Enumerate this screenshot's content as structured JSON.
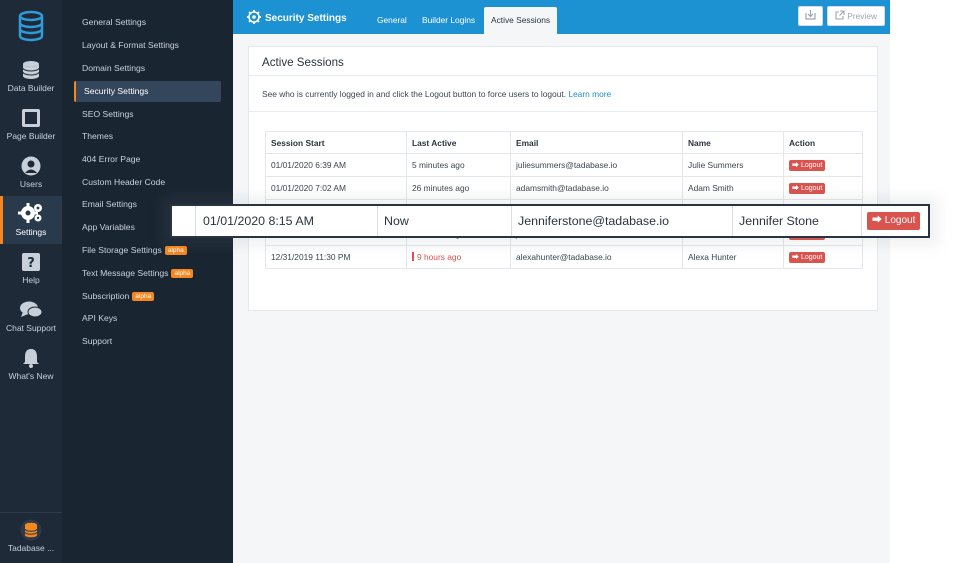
{
  "rail": {
    "items": [
      {
        "label": "Data Builder",
        "icon": "database-icon"
      },
      {
        "label": "Page Builder",
        "icon": "layout-icon"
      },
      {
        "label": "Users",
        "icon": "user-icon"
      },
      {
        "label": "Settings",
        "icon": "gear-icon",
        "active": true
      },
      {
        "label": "Help",
        "icon": "help-icon"
      },
      {
        "label": "Chat Support",
        "icon": "chat-icon"
      },
      {
        "label": "What's New",
        "icon": "bell-icon"
      }
    ],
    "bottom_label": "Tadabase ..."
  },
  "submenu": {
    "items": [
      {
        "label": "General Settings"
      },
      {
        "label": "Layout & Format Settings"
      },
      {
        "label": "Domain Settings"
      },
      {
        "label": "Security Settings",
        "active": true
      },
      {
        "label": "SEO Settings"
      },
      {
        "label": "Themes"
      },
      {
        "label": "404 Error Page"
      },
      {
        "label": "Custom Header Code"
      },
      {
        "label": "Email Settings"
      },
      {
        "label": "App Variables"
      },
      {
        "label": "File Storage Settings",
        "badge": "alpha"
      },
      {
        "label": "Text Message Settings",
        "badge": "alpha"
      },
      {
        "label": "Subscription",
        "badge": "alpha"
      },
      {
        "label": "API Keys"
      },
      {
        "label": "Support"
      }
    ]
  },
  "topbar": {
    "title": "Security Settings",
    "tabs": [
      "General",
      "Builder Logins",
      "Active Sessions"
    ],
    "active_tab": "Active Sessions",
    "preview_label": "Preview"
  },
  "card": {
    "title": "Active Sessions",
    "description": "See who is currently logged in and click the Logout button to force users to logout.",
    "learn_more": "Learn more"
  },
  "table": {
    "headers": [
      "Session Start",
      "Last Active",
      "Email",
      "Name",
      "Action"
    ],
    "action_label": "Logout",
    "rows": [
      {
        "start": "01/01/2020 6:39 AM",
        "last_active": "5 minutes ago",
        "email": "juliesummers@tadabase.io",
        "name": "Julie Summers",
        "warn": false
      },
      {
        "start": "01/01/2020 7:02 AM",
        "last_active": "26 minutes ago",
        "email": "adamsmith@tadabase.io",
        "name": "Adam Smith",
        "warn": false
      },
      {
        "start": "",
        "last_active": "",
        "email": "",
        "name": "",
        "warn": false
      },
      {
        "start": "01/01/2020 8:39 AM",
        "last_active": "5 minutes ago",
        "email": "juliesummers@tadabase.io",
        "name": "Julie Summers",
        "warn": false
      },
      {
        "start": "12/31/2019 11:30 PM",
        "last_active": "9 hours ago",
        "email": "alexahunter@tadabase.io",
        "name": "Alexa Hunter",
        "warn": true
      }
    ]
  },
  "dragged_row": {
    "start": "01/01/2020 8:15 AM",
    "last_active": "Now",
    "email": "Jenniferstone@tadabase.io",
    "name": "Jennifer Stone",
    "action_label": "Logout"
  },
  "colors": {
    "rail_bg": "#1e2a38",
    "submenu_bg": "#1a2532",
    "topbar_bg": "#1c92d2",
    "accent": "#f5871f",
    "danger": "#d9534f"
  }
}
